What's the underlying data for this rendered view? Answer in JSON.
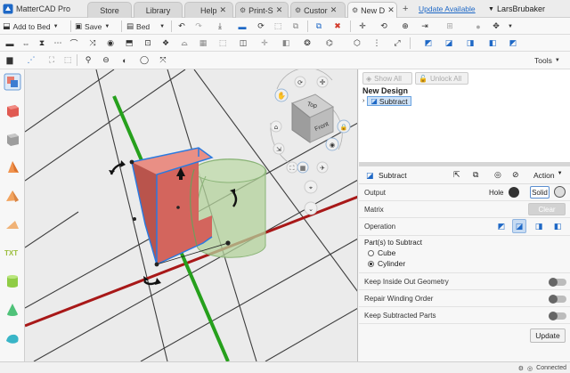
{
  "app": {
    "title": "MatterCAD Pro"
  },
  "tabs": [
    {
      "label": "Store",
      "closable": false
    },
    {
      "label": "Library",
      "closable": false
    },
    {
      "label": "Help",
      "closable": true
    },
    {
      "label": "Print-S",
      "closable": true
    },
    {
      "label": "Custor",
      "closable": true
    },
    {
      "label": "New D",
      "closable": true,
      "active": true
    }
  ],
  "header": {
    "new_tab": "+",
    "update": "Update Available",
    "user": "LarsBrubaker"
  },
  "toolbar1": {
    "add_to_bed": "Add to Bed",
    "save": "Save",
    "bed": "Bed"
  },
  "toolbar2": {
    "tools": "Tools"
  },
  "tree": {
    "show_all": "Show All",
    "unlock_all": "Unlock All",
    "title": "New Design",
    "selected_item": "Subtract"
  },
  "props": {
    "title": "Subtract",
    "action": "Action",
    "output_label": "Output",
    "hole_label": "Hole",
    "solid_label": "Solid",
    "matrix_label": "Matrix",
    "clear_label": "Clear",
    "operation_label": "Operation",
    "parts_label": "Part(s) to Subtract",
    "parts": [
      {
        "label": "Cube",
        "checked": false
      },
      {
        "label": "Cylinder",
        "checked": true
      }
    ],
    "toggles": [
      {
        "label": "Keep Inside Out Geometry"
      },
      {
        "label": "Repair Winding Order"
      },
      {
        "label": "Keep Subtracted Parts"
      }
    ],
    "update_button": "Update"
  },
  "viewcube": {
    "top": "Top",
    "front": "Front"
  },
  "status": {
    "connection": "Connected"
  },
  "colors": {
    "accent": "#1e68c6",
    "cube": "#e0786e",
    "cylinder": "#b7d6a4",
    "x_axis": "#b81d1d",
    "y_axis": "#2aa81f"
  }
}
